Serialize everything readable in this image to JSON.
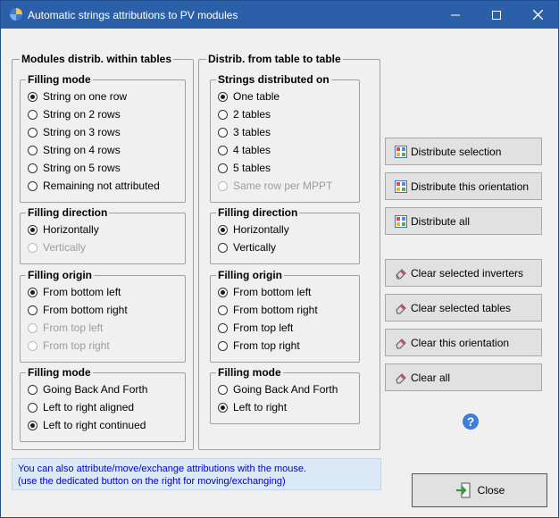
{
  "window": {
    "title": "Automatic strings attributions to PV modules"
  },
  "left_panel": {
    "title": "Modules distrib. within tables",
    "filling_mode": {
      "title": "Filling mode",
      "options": [
        {
          "label": "String on one row",
          "checked": true,
          "disabled": false
        },
        {
          "label": "String on 2 rows",
          "checked": false,
          "disabled": false
        },
        {
          "label": "String on 3 rows",
          "checked": false,
          "disabled": false
        },
        {
          "label": "String on 4 rows",
          "checked": false,
          "disabled": false
        },
        {
          "label": "String on 5 rows",
          "checked": false,
          "disabled": false
        },
        {
          "label": "Remaining not attributed",
          "checked": false,
          "disabled": false
        }
      ]
    },
    "filling_direction": {
      "title": "Filling direction",
      "options": [
        {
          "label": "Horizontally",
          "checked": true,
          "disabled": false
        },
        {
          "label": "Vertically",
          "checked": false,
          "disabled": true
        }
      ]
    },
    "filling_origin": {
      "title": "Filling origin",
      "options": [
        {
          "label": "From bottom left",
          "checked": true,
          "disabled": false
        },
        {
          "label": "From bottom right",
          "checked": false,
          "disabled": false
        },
        {
          "label": "From top left",
          "checked": false,
          "disabled": true
        },
        {
          "label": "From top right",
          "checked": false,
          "disabled": true
        }
      ]
    },
    "filling_mode2": {
      "title": "Filling mode",
      "options": [
        {
          "label": "Going Back And Forth",
          "checked": false,
          "disabled": false
        },
        {
          "label": "Left to right aligned",
          "checked": false,
          "disabled": false
        },
        {
          "label": "Left to right continued",
          "checked": true,
          "disabled": false
        }
      ]
    }
  },
  "right_panel": {
    "title": "Distrib. from table to table",
    "strings_distributed": {
      "title": "Strings distributed on",
      "options": [
        {
          "label": "One table",
          "checked": true,
          "disabled": false
        },
        {
          "label": "2 tables",
          "checked": false,
          "disabled": false
        },
        {
          "label": "3 tables",
          "checked": false,
          "disabled": false
        },
        {
          "label": "4 tables",
          "checked": false,
          "disabled": false
        },
        {
          "label": "5 tables",
          "checked": false,
          "disabled": false
        },
        {
          "label": "Same row per MPPT",
          "checked": false,
          "disabled": true
        }
      ]
    },
    "filling_direction": {
      "title": "Filling direction",
      "options": [
        {
          "label": "Horizontally",
          "checked": true,
          "disabled": false
        },
        {
          "label": "Vertically",
          "checked": false,
          "disabled": false
        }
      ]
    },
    "filling_origin": {
      "title": "Filling origin",
      "options": [
        {
          "label": "From bottom left",
          "checked": true,
          "disabled": false
        },
        {
          "label": "From bottom right",
          "checked": false,
          "disabled": false
        },
        {
          "label": "From top left",
          "checked": false,
          "disabled": false
        },
        {
          "label": "From top right",
          "checked": false,
          "disabled": false
        }
      ]
    },
    "filling_mode": {
      "title": "Filling mode",
      "options": [
        {
          "label": "Going Back And Forth",
          "checked": false,
          "disabled": false
        },
        {
          "label": "Left to right",
          "checked": true,
          "disabled": false
        }
      ]
    }
  },
  "buttons": {
    "distribute_selection": "Distribute selection",
    "distribute_orientation": "Distribute this orientation",
    "distribute_all": "Distribute all",
    "clear_inverters": "Clear selected inverters",
    "clear_tables": "Clear selected tables",
    "clear_orientation": "Clear this orientation",
    "clear_all": "Clear all",
    "close": "Close"
  },
  "info": {
    "line1": "You can also attribute/move/exchange attributions with the mouse.",
    "line2": "(use the dedicated button on the right for moving/exchanging)"
  },
  "colors": {
    "titlebar": "#2b5fa8",
    "info_bg": "#dce9f7",
    "info_text": "#0000cc"
  }
}
